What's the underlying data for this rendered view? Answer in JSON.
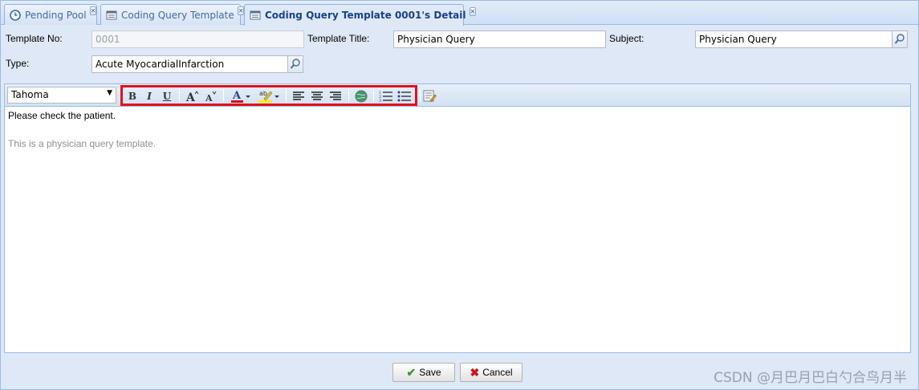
{
  "tabs": [
    {
      "label": "Pending Pool",
      "icon": "clock-icon",
      "active": false
    },
    {
      "label": "Coding Query Template",
      "icon": "table-icon",
      "active": false
    },
    {
      "label": "Coding Query Template 0001's Detail",
      "icon": "table-icon",
      "active": true
    }
  ],
  "form": {
    "template_no_label": "Template No:",
    "template_no_value": "0001",
    "template_title_label": "Template Title:",
    "template_title_value": "Physician Query",
    "subject_label": "Subject:",
    "subject_value": "Physician Query",
    "type_label": "Type:",
    "type_value": "Acute MyocardialInfarction"
  },
  "editor": {
    "font": "Tahoma",
    "toolbar_icons": [
      "bold-icon",
      "italic-icon",
      "underline-icon",
      "grow-font-icon",
      "shrink-font-icon",
      "font-color-icon",
      "highlight-color-icon",
      "align-left-icon",
      "align-center-icon",
      "align-right-icon",
      "insert-link-icon",
      "ordered-list-icon",
      "unordered-list-icon",
      "source-edit-icon"
    ],
    "bold_glyph": "B",
    "italic_glyph": "I",
    "underline_glyph": "U",
    "line1": "Please check the patient.",
    "line2": "This is a physician query template."
  },
  "buttons": {
    "save": "Save",
    "cancel": "Cancel"
  },
  "watermark": "CSDN @月巴月巴白勺合鸟月半",
  "colors": {
    "panel_bg": "#dfe8f6",
    "border": "#99bbe8",
    "highlight": "#e0121b",
    "tab_text": "#15428b"
  }
}
